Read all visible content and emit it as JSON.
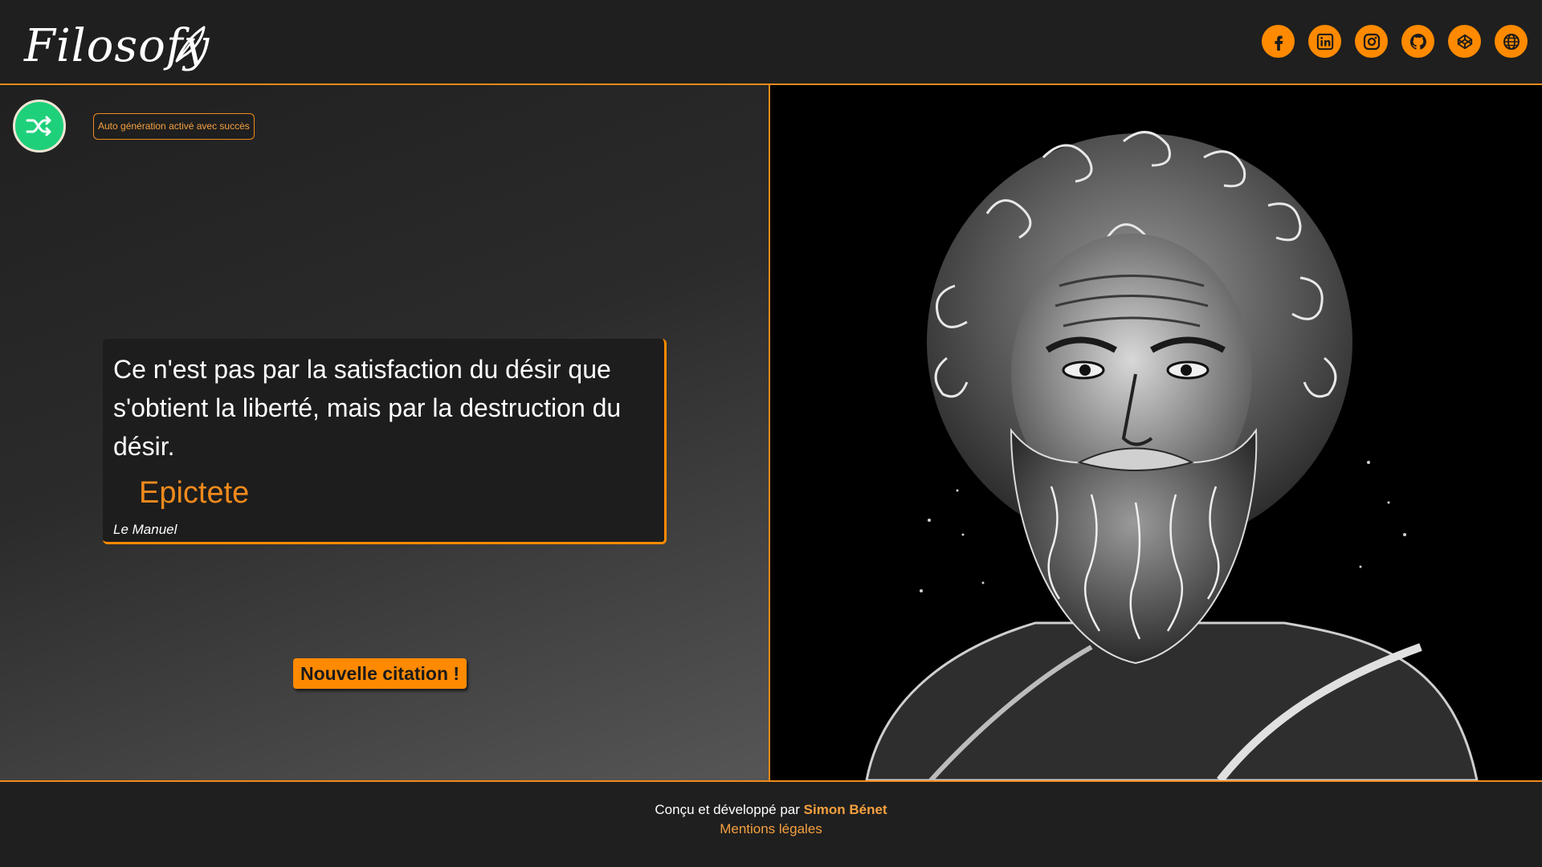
{
  "header": {
    "logo": "Filosofy",
    "socials": [
      {
        "name": "facebook"
      },
      {
        "name": "linkedin"
      },
      {
        "name": "instagram"
      },
      {
        "name": "github"
      },
      {
        "name": "codepen"
      },
      {
        "name": "website"
      }
    ]
  },
  "toolbar": {
    "toast": "Auto génération activé avec succès"
  },
  "quote": {
    "text": "Ce n'est pas par la satisfaction du désir que s'obtient la liberté, mais par la destruction du désir.",
    "author": "Epictete",
    "source": "Le Manuel"
  },
  "actions": {
    "new_quote": "Nouvelle citation !"
  },
  "footer": {
    "credit_prefix": "Conçu et développé par",
    "credit_author": "Simon Bénet",
    "legal": "Mentions légales"
  },
  "colors": {
    "accent": "#ff8a00",
    "shuffle": "#1fd07a",
    "background": "#1f1f1f"
  }
}
